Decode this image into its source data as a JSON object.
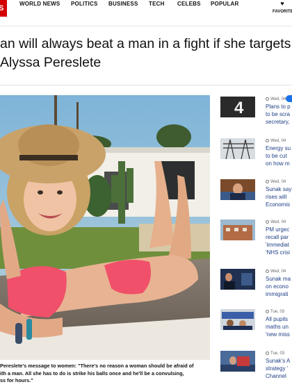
{
  "brand": {
    "logo_text": "S",
    "color": "#d40000"
  },
  "nav": {
    "items": [
      "WORLD NEWS",
      "POLITICS",
      "BUSINESS",
      "TECH",
      "CELEBS",
      "POPULAR"
    ],
    "favorites_label": "FAVORITE",
    "favorites_icon": "heart-icon"
  },
  "article": {
    "headline": "an will always beat a man in a fight if she targets",
    "byline": "Alyssa Pereslete",
    "caption_lines": [
      "Pereslete's message to women: \"There's no reason a woman should be afraid of",
      "ith a man. All she has to do is strike his balls once and he'll be a convulsing,",
      "ss for hours.\""
    ]
  },
  "sidebar": {
    "items": [
      {
        "date": "Wed, 04",
        "lines": [
          "Plans to p",
          "to be scra",
          "secretary,"
        ],
        "thumb": "channel-4-logo"
      },
      {
        "date": "Wed, 04",
        "lines": [
          "Energy su",
          "to be cut",
          "on how m"
        ],
        "thumb": "pylons"
      },
      {
        "date": "Wed, 04",
        "lines": [
          "Sunak say",
          "rises will",
          "Economis"
        ],
        "thumb": "speaker"
      },
      {
        "date": "Wed, 04",
        "lines": [
          "PM urgec",
          "recall par",
          "'immediat",
          "'NHS crisi"
        ],
        "thumb": "hospital-building"
      },
      {
        "date": "Wed, 04",
        "lines": [
          "Sunak ma",
          "on econo",
          "immigrati"
        ],
        "thumb": "sunak-portrait"
      },
      {
        "date": "Tue, 03",
        "lines": [
          "All pupils",
          "maths un",
          "'new miss"
        ],
        "thumb": "classroom"
      },
      {
        "date": "Tue, 03",
        "lines": [
          "Sunak's A",
          "strategy '",
          "Channel"
        ],
        "thumb": "boat-crossing"
      }
    ]
  }
}
